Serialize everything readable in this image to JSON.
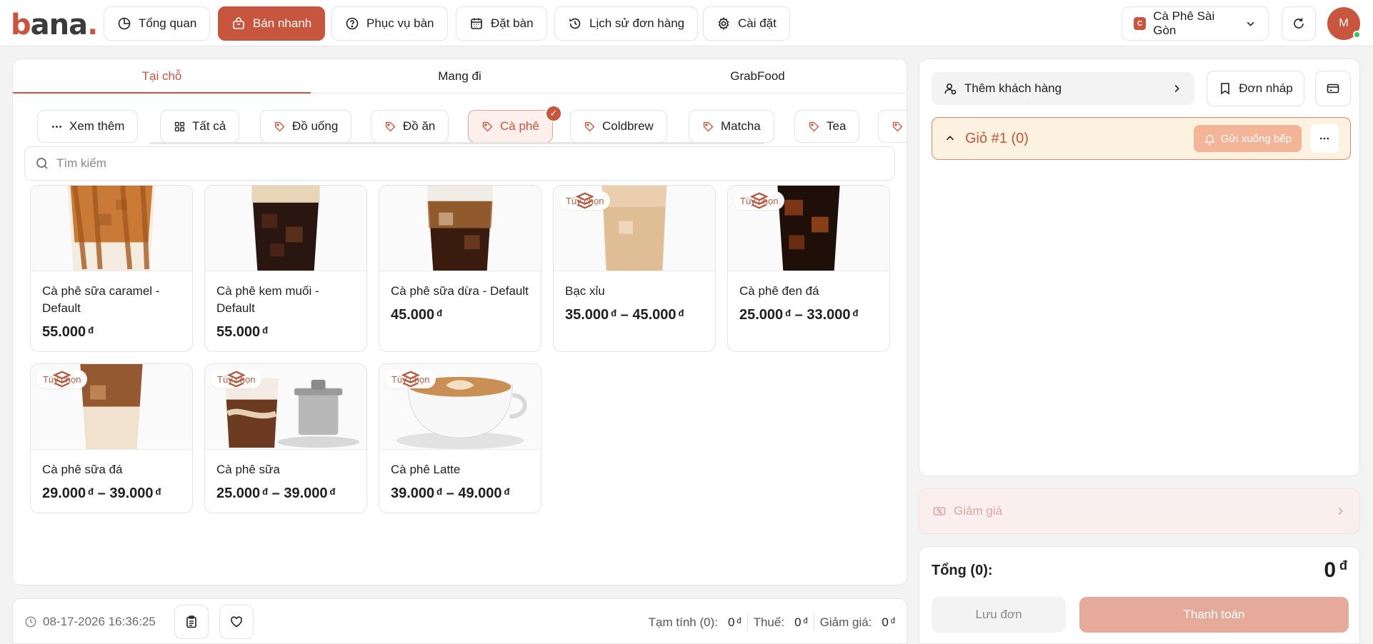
{
  "app": {
    "logo_text": "bana.",
    "accent_color": "#c8553d"
  },
  "nav": [
    {
      "label": "Tổng quan",
      "icon": "chart-pie-icon"
    },
    {
      "label": "Bán nhanh",
      "icon": "basket-icon",
      "active": true
    },
    {
      "label": "Phục vụ bàn",
      "icon": "service-icon"
    },
    {
      "label": "Đặt bàn",
      "icon": "calendar-icon"
    },
    {
      "label": "Lịch sử đơn hàng",
      "icon": "history-icon"
    },
    {
      "label": "Cài đặt",
      "icon": "gear-icon"
    }
  ],
  "store": {
    "badge": "C",
    "name": "Cà Phê Sài Gòn"
  },
  "user": {
    "initial": "M",
    "online": true
  },
  "order_tabs": [
    {
      "label": "Tại chỗ",
      "active": true
    },
    {
      "label": "Mang đi"
    },
    {
      "label": "GrabFood"
    }
  ],
  "categories": [
    {
      "label": "Xem thêm",
      "icon": "dots-icon"
    },
    {
      "label": "Tất cả",
      "icon": "grid-icon"
    },
    {
      "label": "Đồ uống",
      "icon": "tag-icon"
    },
    {
      "label": "Đồ ăn",
      "icon": "tag-icon"
    },
    {
      "label": "Cà phê",
      "icon": "tag-icon",
      "active": true
    },
    {
      "label": "Coldbrew",
      "icon": "tag-icon"
    },
    {
      "label": "Matcha",
      "icon": "tag-icon"
    },
    {
      "label": "Tea",
      "icon": "tag-icon"
    },
    {
      "label": "",
      "icon": "tag-icon"
    }
  ],
  "search": {
    "placeholder": "Tìm kiếm"
  },
  "option_badge_label": "Tùy chọn",
  "currency": "đ",
  "products": [
    {
      "name": "Cà phê sữa caramel - Default",
      "price": "55.000",
      "has_options": false
    },
    {
      "name": "Cà phê kem muối - Default",
      "price": "55.000",
      "has_options": false
    },
    {
      "name": "Cà phê sữa dừa - Default",
      "price": "45.000",
      "has_options": false
    },
    {
      "name": "Bạc xỉu",
      "price_from": "35.000",
      "price_to": "45.000",
      "has_options": true
    },
    {
      "name": "Cà phê đen đá",
      "price_from": "25.000",
      "price_to": "33.000",
      "has_options": true
    },
    {
      "name": "Cà phê sữa đá",
      "price_from": "29.000",
      "price_to": "39.000",
      "has_options": true
    },
    {
      "name": "Cà phê sữa",
      "price_from": "25.000",
      "price_to": "39.000",
      "has_options": true
    },
    {
      "name": "Cà phê Latte",
      "price_from": "39.000",
      "price_to": "49.000",
      "has_options": true
    }
  ],
  "footer": {
    "datetime": "08-17-2026 16:36:25",
    "subtotal_label": "Tạm tính (0):",
    "subtotal_value": "0",
    "tax_label": "Thuế:",
    "tax_value": "0",
    "discount_label": "Giảm giá:",
    "discount_value": "0"
  },
  "cart": {
    "add_customer_label": "Thêm khách hàng",
    "draft_label": "Đơn nháp",
    "title": "Giỏ #1 (0)",
    "send_kitchen_label": "Gửi xuống bếp",
    "discount_label": "Giảm giá",
    "total_label": "Tổng (0):",
    "total_value": "0",
    "save_label": "Lưu đơn",
    "pay_label": "Thanh toán"
  }
}
